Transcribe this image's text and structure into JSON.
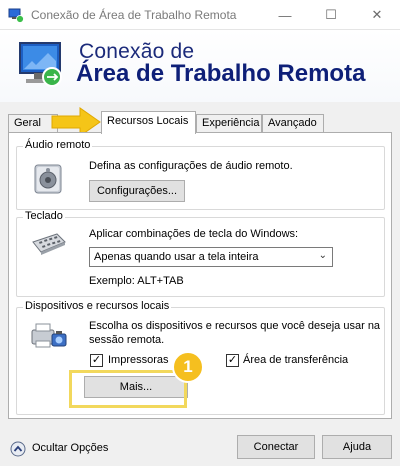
{
  "window": {
    "title": "Conexão de Área de Trabalho Remota",
    "controls": {
      "minimize": "—",
      "maximize": "☐",
      "close": "✕"
    }
  },
  "header": {
    "line1": "Conexão de",
    "line2": "Área de Trabalho Remota",
    "icon": "remote-desktop-icon"
  },
  "tabs": [
    {
      "label": "Geral",
      "active": false
    },
    {
      "label": "Recursos Locais",
      "active": true
    },
    {
      "label": "Experiência",
      "active": false
    },
    {
      "label": "Avançado",
      "active": false
    }
  ],
  "audio": {
    "group_label": "Áudio remoto",
    "description": "Defina as configurações de áudio remoto.",
    "button": "Configurações...",
    "icon": "speaker-icon"
  },
  "keyboard": {
    "group_label": "Teclado",
    "description": "Aplicar combinações de tecla do Windows:",
    "selected": "Apenas quando usar a tela inteira",
    "example": "Exemplo: ALT+TAB",
    "icon": "keyboard-icon"
  },
  "devices": {
    "group_label": "Dispositivos e recursos locais",
    "description_line1": "Escolha os dispositivos e recursos que você deseja usar na",
    "description_line2": "sessão remota.",
    "printers_label": "Impressoras",
    "printers_checked": true,
    "clipboard_label": "Área de transferência",
    "clipboard_checked": true,
    "more_button": "Mais...",
    "icon": "devices-icon"
  },
  "annotation": {
    "badge_number": "1",
    "accent_color": "#f5bf1f"
  },
  "footer": {
    "hide_options": "Ocultar Opções",
    "connect": "Conectar",
    "help": "Ajuda"
  }
}
